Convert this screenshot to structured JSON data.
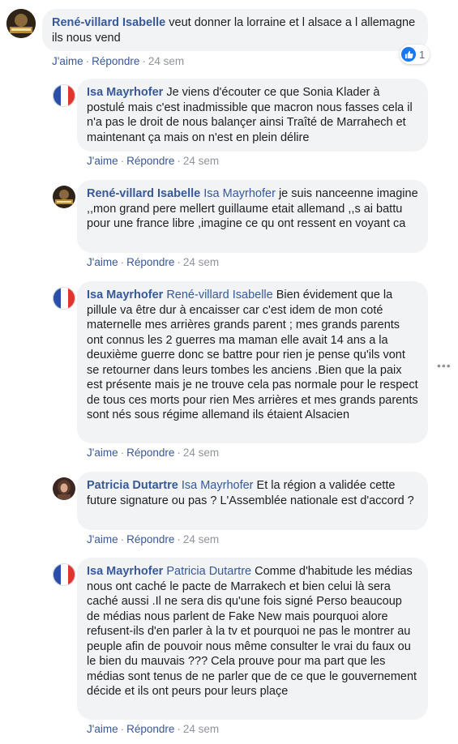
{
  "comments": [
    {
      "author": "René-villard Isabelle",
      "mention": "",
      "text": "veut donner la lorraine et l alsace a l allemagne ils nous vend",
      "like": "J'aime",
      "reply": "Répondre",
      "time": "24 sem",
      "reaction_count": "1"
    },
    {
      "author": "Isa Mayrhofer",
      "mention": "",
      "text": "Je viens d'écouter ce que Sonia Klader à postulé mais c'est inadmissible que macron nous fasses cela il n'a pas le droit de nous balançer ainsi Traîté de Marrahech et maintenant ça mais on n'est en plein délire",
      "like": "J'aime",
      "reply": "Répondre",
      "time": "24 sem"
    },
    {
      "author": "René-villard Isabelle",
      "mention": "Isa Mayrhofer",
      "text": "je suis nanceenne imagine ,,mon grand pere mellert guillaume etait allemand ,,s ai battu pour une france libre ,imagine ce qu ont ressent en voyant ca",
      "like": "J'aime",
      "reply": "Répondre",
      "time": "24 sem"
    },
    {
      "author": "Isa Mayrhofer",
      "mention": "René-villard Isabelle",
      "text": "Bien évidement que la pillule va être dur à encaisser car c'est idem de mon coté maternelle mes arrières grands parent ; mes grands parents ont connus les 2 guerres ma maman elle avait 14 ans a la deuxième guerre donc se battre pour rien je pense qu'ils vont se retourner dans leurs tombes les anciens .Bien que la paix est présente mais je ne trouve cela pas normale pour le respect de tous ces morts pour rien Mes arrières et mes grands parents sont nés sous régime allemand ils étaient Alsacien",
      "like": "J'aime",
      "reply": "Répondre",
      "time": "24 sem"
    },
    {
      "author": "Patricia Dutartre",
      "mention": "Isa Mayrhofer",
      "text": "Et la région a validée cette future signature ou pas ? L'Assemblée nationale est d'accord ?",
      "like": "J'aime",
      "reply": "Répondre",
      "time": "24 sem"
    },
    {
      "author": "Isa Mayrhofer",
      "mention": "Patricia Dutartre",
      "text": "Comme d'habitude les médias nous ont caché le pacte de Marrakech et bien celui là sera caché aussi .Il ne sera dis qu'une fois signé Perso beaucoup de médias nous parlent de Fake New mais pourquoi alore refusent-ils d'en parler à la tv et pourquoi ne pas le montrer au peuple afin de pouvoir nous même consulter le vrai du faux ou le bien du mauvais ??? Cela prouve pour ma part que les médias sont tenus de ne parler que de ce que le gouvernement décide et ils ont peurs pour leurs plaçe",
      "like": "J'aime",
      "reply": "Répondre",
      "time": "24 sem"
    }
  ],
  "colors": {
    "link": "#385898",
    "bubble": "#f2f3f5",
    "meta": "#90949c",
    "like_blue": "#1877f2"
  },
  "icons": [
    "avatar-photo",
    "french-flag-avatar",
    "like-thumb-icon",
    "more-options-icon"
  ]
}
